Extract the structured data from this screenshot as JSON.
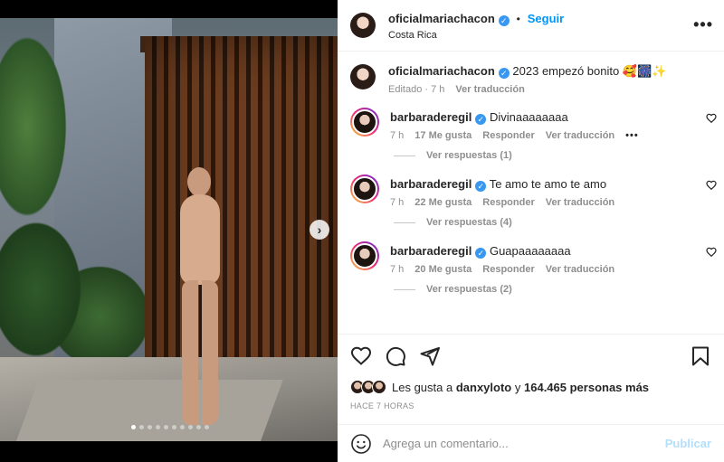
{
  "post": {
    "username": "oficialmariachacon",
    "location": "Costa Rica",
    "follow_label": "Seguir",
    "separator": "•",
    "carousel": {
      "slide_count": 10,
      "active_index": 0
    }
  },
  "caption": {
    "username": "oficialmariachacon",
    "text": "2023 empezó bonito 🥰🎆✨",
    "edited_label": "Editado",
    "time": "7 h",
    "translate_label": "Ver traducción"
  },
  "comments": [
    {
      "username": "barbaraderegil",
      "text": "Divinaaaaaaaa",
      "time": "7 h",
      "likes": "17 Me gusta",
      "reply_label": "Responder",
      "translate_label": "Ver traducción",
      "more": "•••",
      "replies_label": "Ver respuestas (1)"
    },
    {
      "username": "barbaraderegil",
      "text": "Te amo te amo te amo",
      "time": "7 h",
      "likes": "22 Me gusta",
      "reply_label": "Responder",
      "translate_label": "Ver traducción",
      "replies_label": "Ver respuestas (4)"
    },
    {
      "username": "barbaraderegil",
      "text": "Guapaaaaaaaa",
      "time": "7 h",
      "likes": "20 Me gusta",
      "reply_label": "Responder",
      "translate_label": "Ver traducción",
      "replies_label": "Ver respuestas (2)"
    }
  ],
  "likes": {
    "prefix": "Les gusta a",
    "user": "danxyloto",
    "connector": "y",
    "others": "164.465 personas más"
  },
  "posted_time": "HACE 7 HORAS",
  "add_comment": {
    "placeholder": "Agrega un comentario...",
    "post_label": "Publicar"
  },
  "icons": {
    "like": "heart-icon",
    "comment": "comment-icon",
    "share": "paper-plane-icon",
    "save": "bookmark-icon",
    "emoji": "smiley-icon",
    "more": "more-horizontal-icon",
    "verified": "verified-badge-icon",
    "next": "chevron-right-icon"
  },
  "colors": {
    "accent": "#0095f6",
    "post_disabled": "#b2dffc",
    "verified": "#3897f0"
  }
}
